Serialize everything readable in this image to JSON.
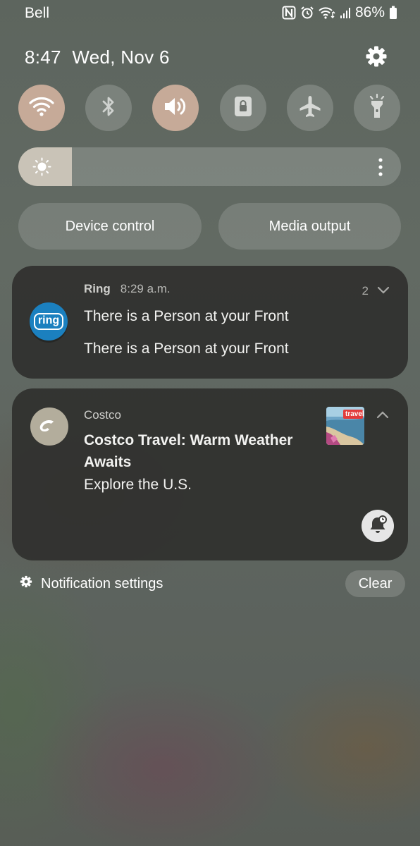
{
  "status_bar": {
    "carrier": "Bell",
    "battery": "86%",
    "icons": [
      "nfc-icon",
      "alarm-icon",
      "wifi-data-icon",
      "signal-icon",
      "battery-icon"
    ]
  },
  "header": {
    "time": "8:47",
    "date": "Wed, Nov 6"
  },
  "quick_settings": {
    "toggles": [
      {
        "name": "Wi-Fi",
        "icon": "wifi-icon",
        "on": true
      },
      {
        "name": "Bluetooth",
        "icon": "bluetooth-icon",
        "on": false
      },
      {
        "name": "Sound",
        "icon": "volume-icon",
        "on": true
      },
      {
        "name": "Portrait lock",
        "icon": "lock-icon",
        "on": false
      },
      {
        "name": "Airplane mode",
        "icon": "airplane-icon",
        "on": false
      },
      {
        "name": "Flashlight",
        "icon": "flashlight-icon",
        "on": false
      }
    ],
    "brightness_level": 0.14,
    "device_control_label": "Device control",
    "media_output_label": "Media output"
  },
  "notifications": [
    {
      "app": "Ring",
      "time": "8:29 a.m.",
      "count": "2",
      "lines": [
        "There is a Person at your Front",
        "There is a Person at your Front"
      ]
    },
    {
      "app": "Costco",
      "title": "Costco Travel:  Warm Weather Awaits",
      "body": "Explore the U.S.",
      "thumbnail_text": "travel"
    }
  ],
  "footer": {
    "settings_label": "Notification settings",
    "clear_label": "Clear"
  },
  "colors": {
    "toggle_on": "#c6aa98",
    "ring_blue": "#1b80bf",
    "card_bg": "#30302e"
  }
}
